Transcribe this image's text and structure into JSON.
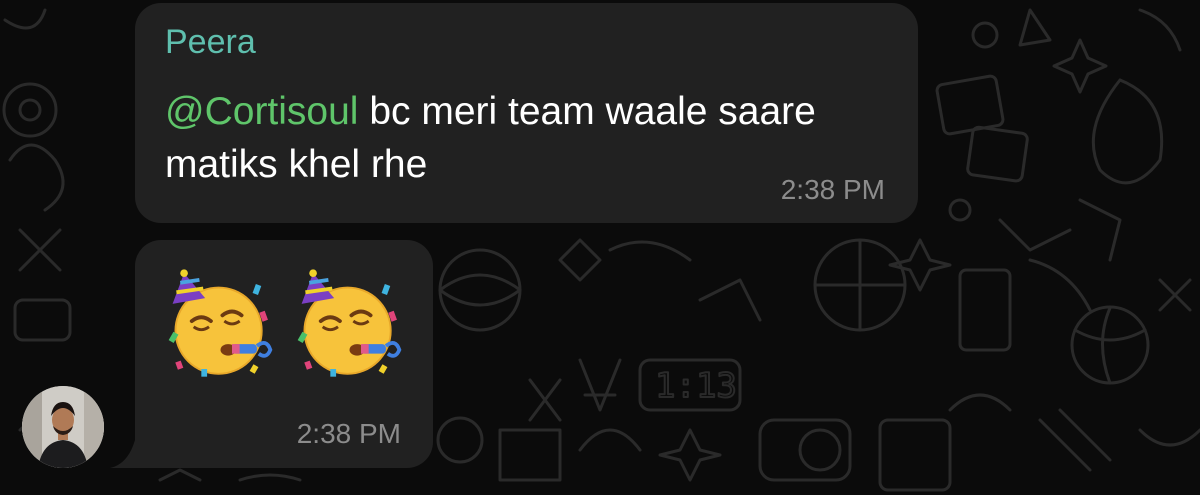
{
  "chat": {
    "background_color": "#0b0b0b",
    "bubble_color": "#212121"
  },
  "messages": [
    {
      "sender": "Peera",
      "sender_color": "#5fbfae",
      "mention": "@Cortisoul",
      "mention_color": "#5fc56a",
      "text": " bc meri team waale saare matiks khel rhe",
      "time": "2:38 PM"
    },
    {
      "emojis": [
        "partying-face-emoji",
        "partying-face-emoji"
      ],
      "time": "2:38 PM"
    }
  ],
  "avatar": {
    "name": "user-avatar"
  }
}
